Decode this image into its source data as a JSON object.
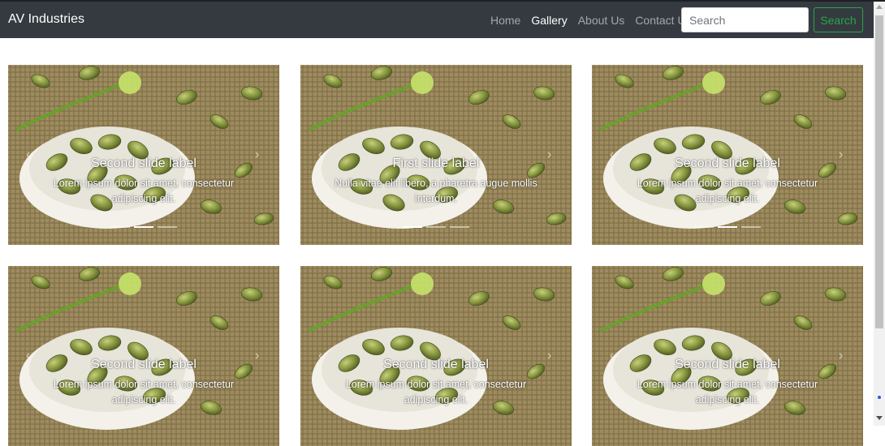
{
  "brand": "AV Industries",
  "nav": {
    "items": [
      {
        "label": "Home",
        "active": false
      },
      {
        "label": "Gallery",
        "active": true
      },
      {
        "label": "About Us",
        "active": false
      },
      {
        "label": "Contact Us",
        "active": false
      }
    ],
    "search_placeholder": "Search",
    "search_button": "Search"
  },
  "gallery": {
    "cards": [
      {
        "title": "Second slide label",
        "text": "Lorem ipsum dolor sit amet, consectetur adipiscing elit.",
        "active_indicator": 2
      },
      {
        "title": "First slide label",
        "text": "Nulla vitae elit libero, a pharetra augue mollis interdum.",
        "active_indicator": 1
      },
      {
        "title": "Second slide label",
        "text": "Lorem ipsum dolor sit amet, consectetur adipiscing elit.",
        "active_indicator": 2
      },
      {
        "title": "Second slide label",
        "text": "Lorem ipsum dolor sit amet, consectetur adipiscing elit.",
        "active_indicator": 2
      },
      {
        "title": "Second slide label",
        "text": "Lorem ipsum dolor sit amet, consectetur adipiscing elit.",
        "active_indicator": 2
      },
      {
        "title": "Second slide label",
        "text": "Lorem ipsum dolor sit amet, consectetur adipiscing elit.",
        "active_indicator": 2
      }
    ]
  },
  "colors": {
    "navbar": "#343a40",
    "search_button": "#28a745"
  }
}
